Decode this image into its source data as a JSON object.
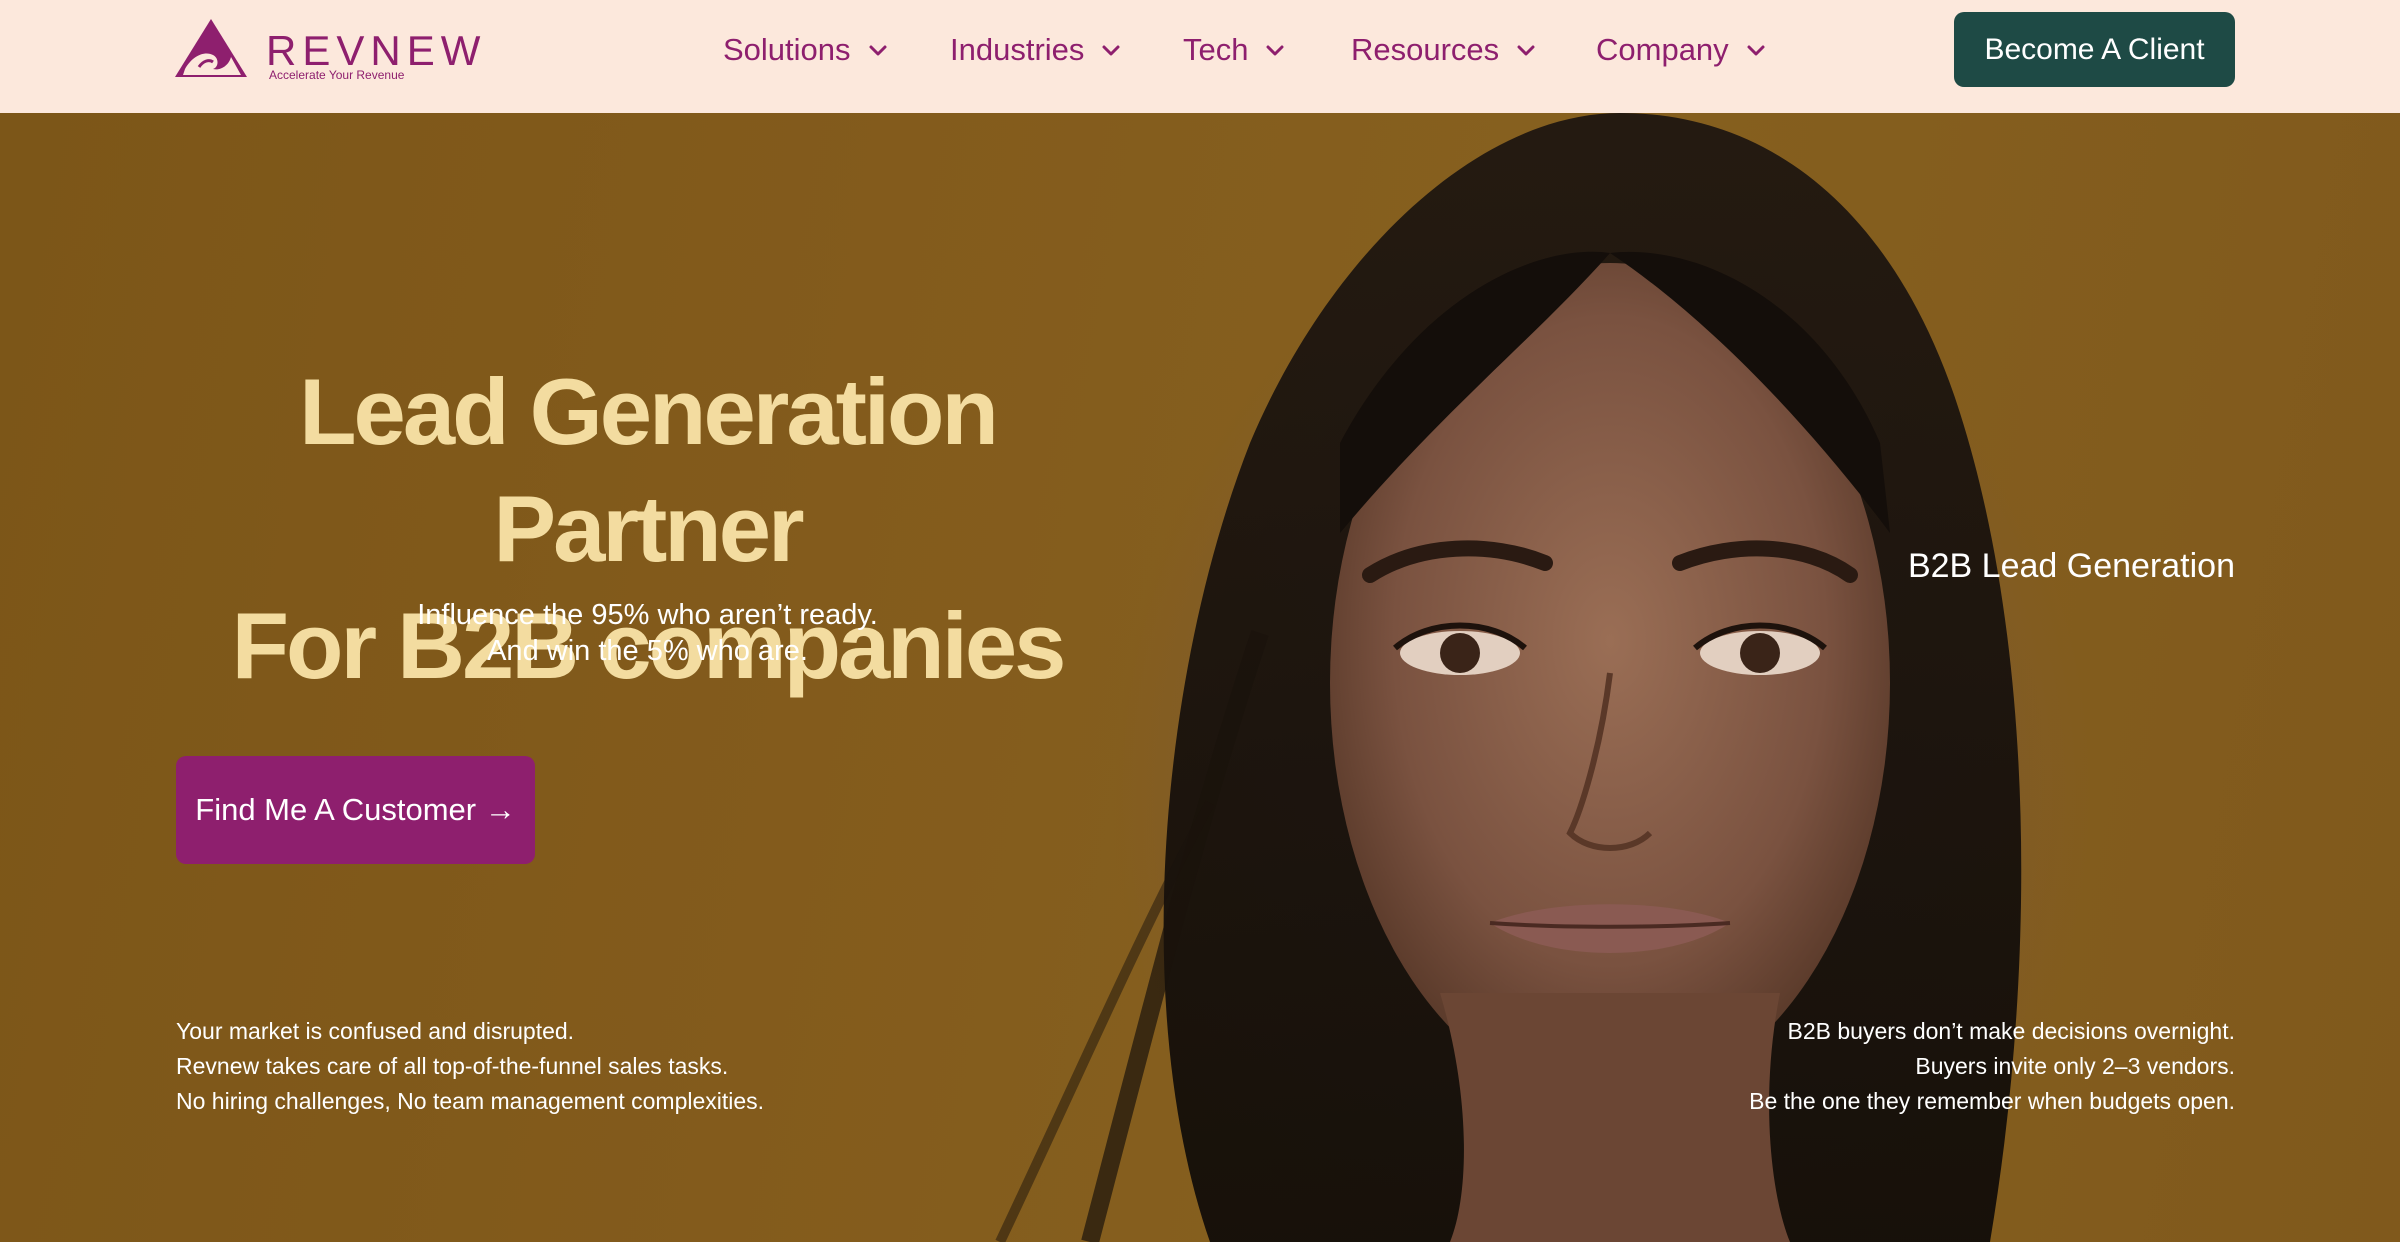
{
  "header": {
    "logo": {
      "word": "REVNEW",
      "tagline": "Accelerate Your Revenue",
      "icon": "wave-triangle-logo"
    },
    "nav": [
      {
        "label": "Solutions",
        "icon": "chevron-down-icon"
      },
      {
        "label": "Industries",
        "icon": "chevron-down-icon"
      },
      {
        "label": "Tech",
        "icon": "chevron-down-icon"
      },
      {
        "label": "Resources",
        "icon": "chevron-down-icon"
      },
      {
        "label": "Company",
        "icon": "chevron-down-icon"
      }
    ],
    "cta_label": "Become A Client"
  },
  "hero": {
    "headline_line1": "Lead Generation Partner",
    "headline_line2": "For B2B companies",
    "subline_line1": "Influence the 95% who aren’t ready.",
    "subline_line2": "And win the 5% who are.",
    "cta_label": "Find Me A Customer →",
    "side_label": "B2B Lead Generation",
    "left_lines": [
      "Your market is confused and disrupted.",
      "Revnew takes care of all top-of-the-funnel sales tasks.",
      "No hiring challenges, No team management complexities."
    ],
    "right_lines": [
      "B2B buyers don’t make decisions overnight.",
      "Buyers invite only 2–3 vendors.",
      "Be the one they remember when budgets open."
    ]
  },
  "colors": {
    "header_bg": "#fce8dc",
    "brand_magenta": "#8e1f6e",
    "cta_green": "#1e4a45",
    "headline_cream": "#f3dca0",
    "hero_bg": "#835b1c"
  }
}
